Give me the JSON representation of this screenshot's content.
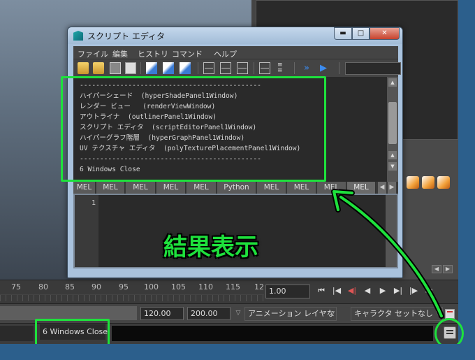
{
  "window": {
    "title": "スクリプト エディタ",
    "controls": {
      "minimize": "▬",
      "maximize": "□",
      "close": "✕"
    }
  },
  "menubar": [
    "ファイル",
    "編集",
    "ヒストリ",
    "コマンド",
    "ヘルプ"
  ],
  "toolbar_icons": [
    "open-script-icon",
    "source-script-icon",
    "save-script-icon",
    "save-script-shelf-icon",
    "clear-history-icon",
    "clear-input-icon",
    "clear-all-icon",
    "show-history-icon",
    "show-input-icon",
    "show-both-icon",
    "echo-commands-icon",
    "line-numbers-icon",
    "execute-all-icon",
    "execute-icon"
  ],
  "output": {
    "lines": [
      "---------------------------------------------",
      "ハイパーシェード  (hyperShadePanel1Window)",
      "レンダー ビュー   (renderViewWindow)",
      "アウトライナ  (outlinerPanel1Window)",
      "スクリプト エディタ  (scriptEditorPanel1Window)",
      "ハイパーグラフ階層  (hyperGraphPanel1Window)",
      "UV テクスチャ エディタ  (polyTexturePlacementPanel1Window)",
      "---------------------------------------------",
      "6 Windows Close"
    ]
  },
  "tabs": [
    "MEL",
    "MEL",
    "MEL",
    "MEL",
    "MEL",
    "Python",
    "MEL",
    "MEL",
    "MEL",
    "MEL"
  ],
  "input": {
    "line_number": "1"
  },
  "annotation": "結果表示",
  "timeline": {
    "ticks": [
      "75",
      "80",
      "85",
      "90",
      "95",
      "100",
      "105",
      "110",
      "115",
      "12"
    ],
    "current_frame": "1.00",
    "playback": [
      "⏮",
      "|◀",
      "◀|",
      "◀",
      "▶",
      "▶|",
      "|▶",
      "⏭"
    ]
  },
  "range": {
    "end_value": "120.00",
    "max_value": "200.00",
    "anim_layer": "アニメーション レイヤなし",
    "character_set": "キャラクタ セットなし"
  },
  "command_line": {
    "result": "6 Windows Close"
  },
  "colors": {
    "highlight": "#1ee13c",
    "maya_blue": "#2c5f8c",
    "window_frame": "#a9c2dd"
  }
}
